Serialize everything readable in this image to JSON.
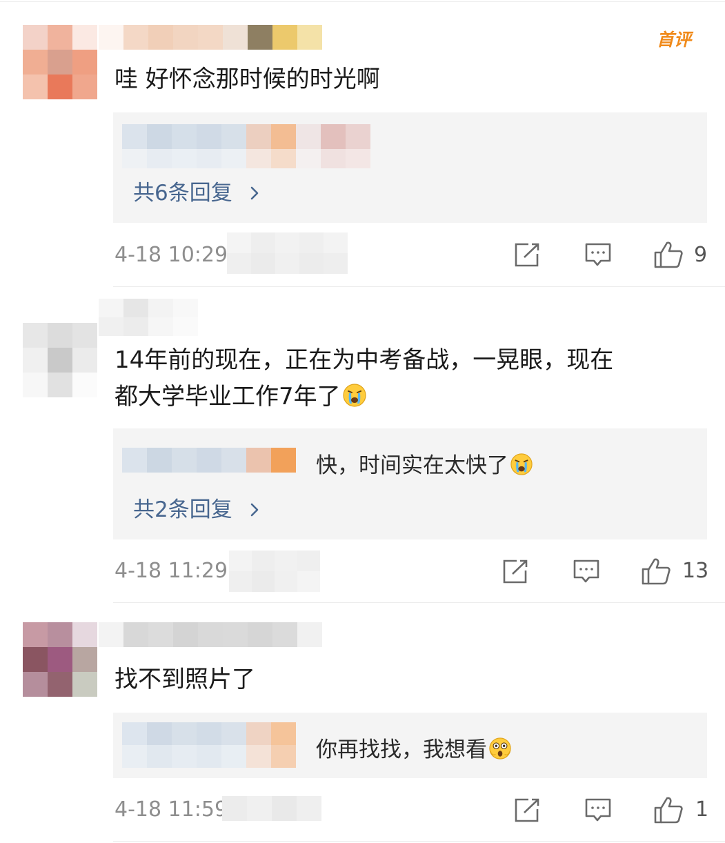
{
  "colors": {
    "link": "#47668f",
    "time": "#8e8e8e",
    "badge": "#f08a1a",
    "reply_bg": "#f4f4f4"
  },
  "comments": [
    {
      "text": "哇 好怀念那时候的时光啊",
      "badge": "首评",
      "reply_preview": "",
      "reply_count_label": "共6条回复",
      "time": "4-18 10:29",
      "likes": "9",
      "icons": [
        "share-icon",
        "comment-icon",
        "like-icon"
      ]
    },
    {
      "text_line1": "14年前的现在，正在为中考备战，一晃眼，现在",
      "text_line2": "都大学毕业工作7年了",
      "reply_preview": "快，时间实在太快了",
      "reply_count_label": "共2条回复",
      "time": "4-18 11:29",
      "likes": "13"
    },
    {
      "text": "找不到照片了",
      "reply_preview": "你再找找，我想看",
      "time": "4-18 11:59",
      "likes": "1"
    }
  ]
}
